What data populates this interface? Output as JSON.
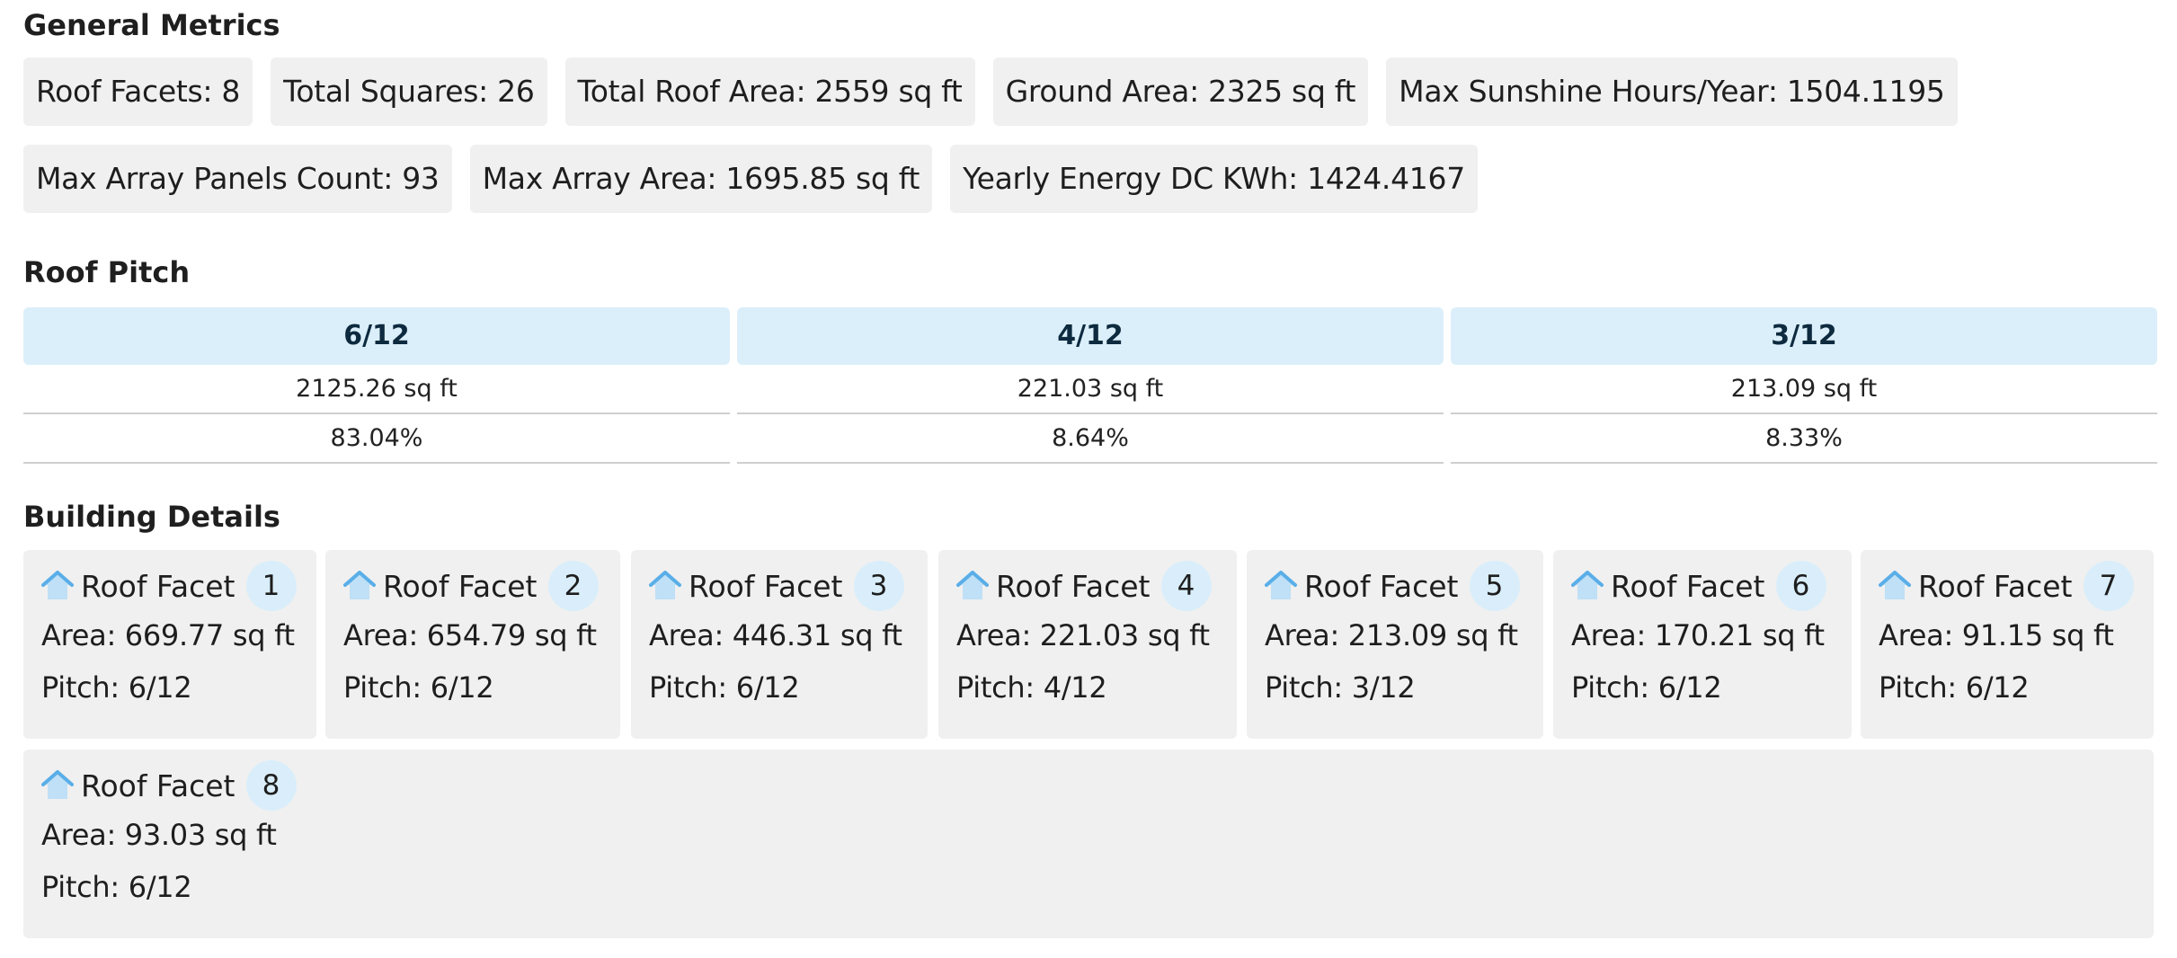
{
  "general": {
    "title": "General Metrics",
    "row1": [
      "Roof Facets: 8",
      "Total Squares: 26",
      "Total Roof Area: 2559 sq ft",
      "Ground Area: 2325 sq ft",
      "Max Sunshine Hours/Year: 1504.1195"
    ],
    "row2": [
      "Max Array Panels Count: 93",
      "Max Array Area: 1695.85 sq ft",
      "Yearly Energy DC KWh: 1424.4167"
    ]
  },
  "pitch": {
    "title": "Roof Pitch",
    "columns": [
      {
        "label": "6/12",
        "area": "2125.26 sq ft",
        "percent": "83.04%"
      },
      {
        "label": "4/12",
        "area": "221.03 sq ft",
        "percent": "8.64%"
      },
      {
        "label": "3/12",
        "area": "213.09 sq ft",
        "percent": "8.33%"
      }
    ]
  },
  "building": {
    "title": "Building Details",
    "facets": [
      {
        "label": "Roof Facet",
        "num": "1",
        "area": "Area: 669.77 sq ft",
        "pitch": "Pitch: 6/12"
      },
      {
        "label": "Roof Facet",
        "num": "2",
        "area": "Area: 654.79 sq ft",
        "pitch": "Pitch: 6/12"
      },
      {
        "label": "Roof Facet",
        "num": "3",
        "area": "Area: 446.31 sq ft",
        "pitch": "Pitch: 6/12"
      },
      {
        "label": "Roof Facet",
        "num": "4",
        "area": "Area: 221.03 sq ft",
        "pitch": "Pitch: 4/12"
      },
      {
        "label": "Roof Facet",
        "num": "5",
        "area": "Area: 213.09 sq ft",
        "pitch": "Pitch: 3/12"
      },
      {
        "label": "Roof Facet",
        "num": "6",
        "area": "Area: 170.21 sq ft",
        "pitch": "Pitch: 6/12"
      },
      {
        "label": "Roof Facet",
        "num": "7",
        "area": "Area: 91.15 sq ft",
        "pitch": "Pitch: 6/12"
      },
      {
        "label": "Roof Facet",
        "num": "8",
        "area": "Area: 93.03 sq ft",
        "pitch": "Pitch: 6/12"
      }
    ]
  },
  "icons": {
    "facet": "house-icon"
  },
  "colors": {
    "chip_bg": "#f0f0f0",
    "pitch_header_bg": "#dbeffa",
    "badge_bg": "#d9eefa",
    "icon_blue": "#5aaee8"
  }
}
